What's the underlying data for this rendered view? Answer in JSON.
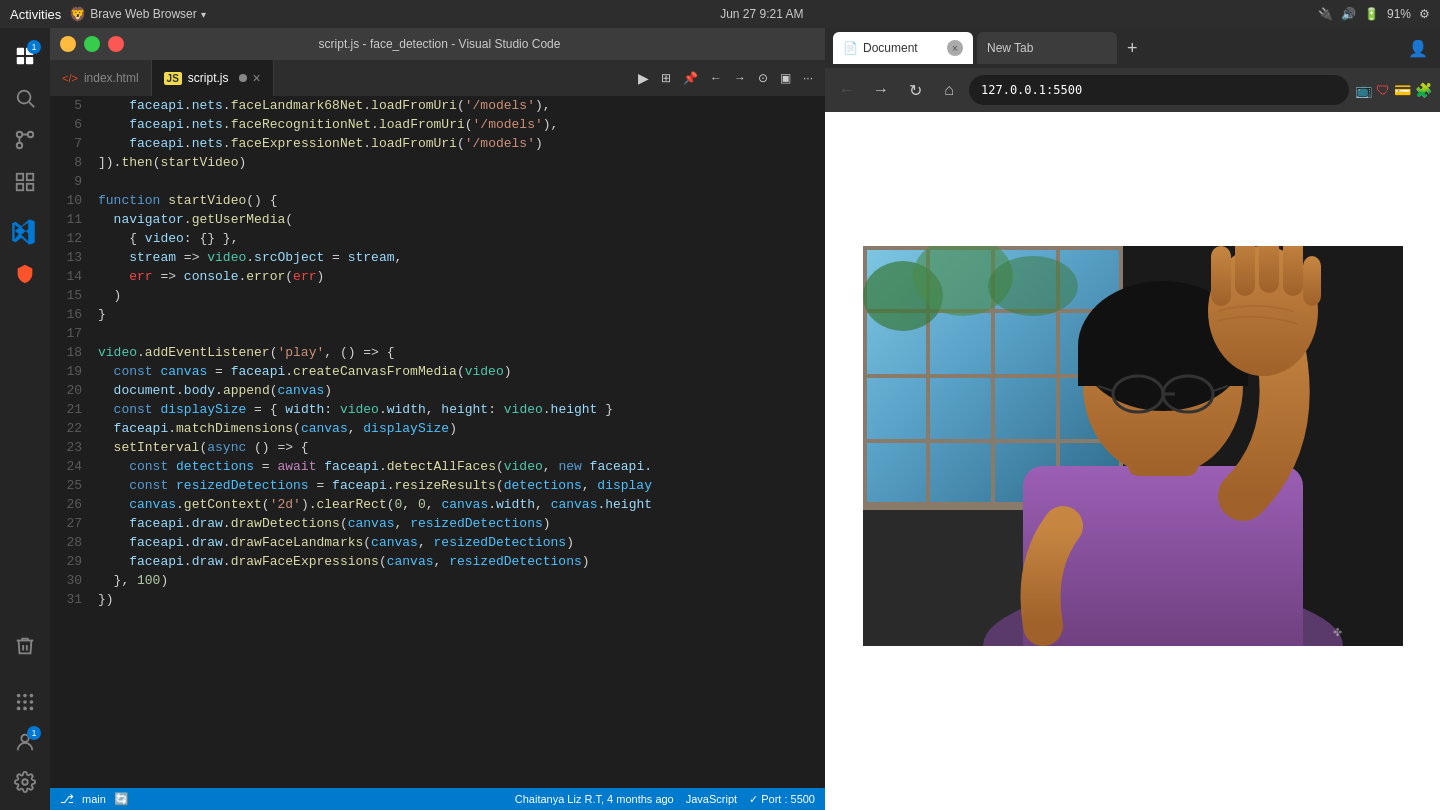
{
  "topbar": {
    "activities": "Activities",
    "brave_label": "Brave Web Browser",
    "datetime": "Jun 27  9:21 AM",
    "battery": "91%"
  },
  "vscode": {
    "title": "script.js - face_detection - Visual Studio Code",
    "tabs": [
      {
        "id": "index-html",
        "label": "index.html",
        "icon": "html",
        "active": false,
        "modified": false
      },
      {
        "id": "script-js",
        "label": "script.js",
        "icon": "js",
        "active": true,
        "modified": true
      }
    ],
    "code_lines": [
      {
        "num": "5",
        "content": "    faceapi.nets.faceLandmark68Net.loadFromUri('/models'),"
      },
      {
        "num": "6",
        "content": "    faceapi.nets.faceRecognitionNet.loadFromUri('/models'),"
      },
      {
        "num": "7",
        "content": "    faceapi.nets.faceExpressionNet.loadFromUri('/models')"
      },
      {
        "num": "8",
        "content": "]).then(startVideo)"
      },
      {
        "num": "9",
        "content": ""
      },
      {
        "num": "10",
        "content": "function startVideo() {"
      },
      {
        "num": "11",
        "content": "  navigator.getUserMedia("
      },
      {
        "num": "12",
        "content": "    { video: {} },"
      },
      {
        "num": "13",
        "content": "    stream => video.srcObject = stream,"
      },
      {
        "num": "14",
        "content": "    err => console.error(err)"
      },
      {
        "num": "15",
        "content": "  )"
      },
      {
        "num": "16",
        "content": "}"
      },
      {
        "num": "17",
        "content": ""
      },
      {
        "num": "18",
        "content": "video.addEventListener('play', () => {"
      },
      {
        "num": "19",
        "content": "  const canvas = faceapi.createCanvasFromMedia(video)"
      },
      {
        "num": "20",
        "content": "  document.body.append(canvas)"
      },
      {
        "num": "21",
        "content": "  const displaySize = { width: video.width, height: video.height }"
      },
      {
        "num": "22",
        "content": "  faceapi.matchDimensions(canvas, displaySize)"
      },
      {
        "num": "23",
        "content": "  setInterval(async () => {"
      },
      {
        "num": "24",
        "content": "    const detections = await faceapi.detectAllFaces(video, new faceapi."
      },
      {
        "num": "25",
        "content": "    const resizedDetections = faceapi.resizeResults(detections, display"
      },
      {
        "num": "26",
        "content": "    canvas.getContext('2d').clearRect(0, 0, canvas.width, canvas.height"
      },
      {
        "num": "27",
        "content": "    faceapi.draw.drawDetections(canvas, resizedDetections)"
      },
      {
        "num": "28",
        "content": "    faceapi.draw.drawFaceLandmarks(canvas, resizedDetections)"
      },
      {
        "num": "29",
        "content": "    faceapi.draw.drawFaceExpressions(canvas, resizedDetections)"
      },
      {
        "num": "30",
        "content": "  }, 100)"
      },
      {
        "num": "31",
        "content": "})"
      }
    ],
    "statusbar": {
      "branch": "main",
      "author": "Chaitanya Liz R.T, 4 months ago",
      "language": "JavaScript",
      "port": "Port : 5500"
    }
  },
  "browser": {
    "tabs": [
      {
        "id": "document-tab",
        "label": "Document",
        "active": true
      },
      {
        "id": "new-tab",
        "label": "New Tab",
        "active": false
      }
    ],
    "address": "127.0.0.1:5500",
    "back_btn": "←",
    "forward_btn": "→",
    "refresh_btn": "↻",
    "home_btn": "⌂"
  }
}
